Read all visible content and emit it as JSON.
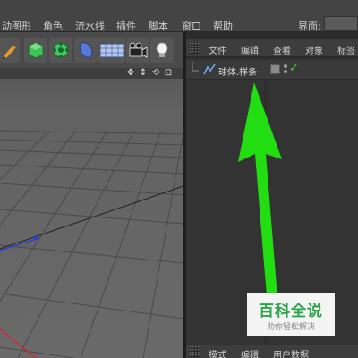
{
  "menubar": {
    "items": [
      "动图形",
      "角色",
      "流水线",
      "插件",
      "脚本",
      "窗口",
      "帮助"
    ],
    "layout_label": "界面:"
  },
  "toolbar": {
    "tools": [
      "pen-icon",
      "cube-icon",
      "gear-icon",
      "capsule-icon",
      "floor-icon",
      "camera-icon",
      "light-icon"
    ]
  },
  "viewport_nav": {
    "controls": [
      "✥",
      "↕",
      "⟲",
      "⊡"
    ]
  },
  "object_manager": {
    "menu": [
      "文件",
      "编辑",
      "查看",
      "对象",
      "标签"
    ],
    "objects": [
      {
        "name": "球体.样条",
        "visible": true
      }
    ]
  },
  "attribute_manager": {
    "menu": [
      "模式",
      "编辑",
      "用户数据"
    ]
  },
  "watermark": {
    "title": "百科全说",
    "subtitle": "助你轻松解决"
  },
  "colors": {
    "arrow": "#22dd11",
    "check": "#39d43b",
    "axis_x": "#e02020",
    "axis_z": "#2040e0"
  }
}
